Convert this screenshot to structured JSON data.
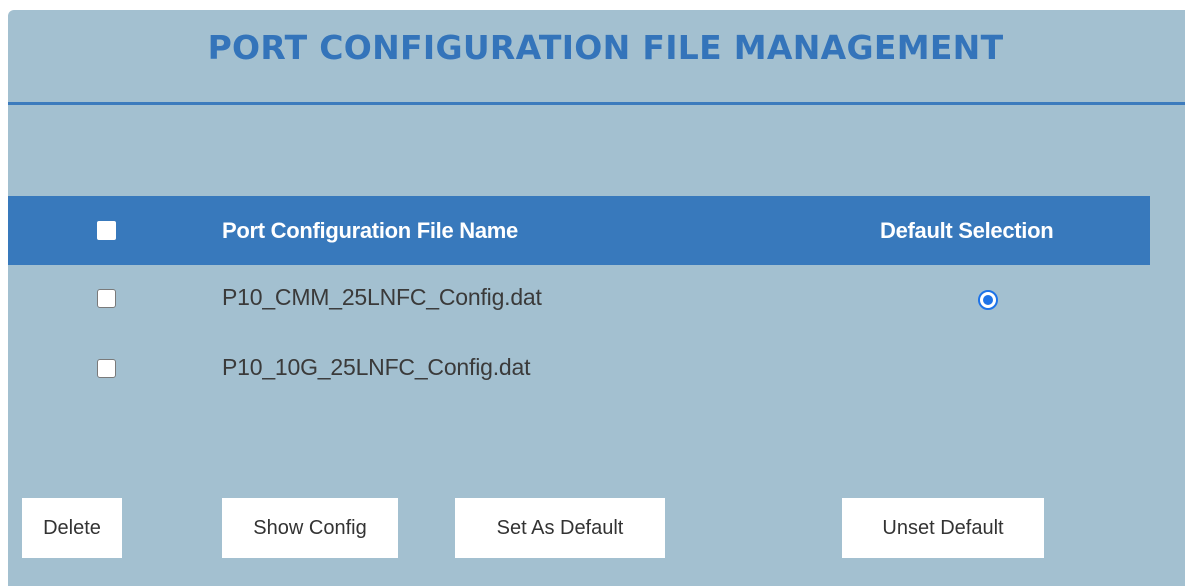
{
  "header": {
    "title": "PORT CONFIGURATION FILE MANAGEMENT"
  },
  "table": {
    "columns": {
      "select_all": "",
      "file_name": "Port Configuration File Name",
      "default_selection": "Default Selection"
    },
    "rows": [
      {
        "file_name": "P10_CMM_25LNFC_Config.dat",
        "checked": false,
        "is_default": true
      },
      {
        "file_name": "P10_10G_25LNFC_Config.dat",
        "checked": false,
        "is_default": false
      }
    ]
  },
  "actions": {
    "delete_label": "Delete",
    "show_config_label": "Show Config",
    "set_default_label": "Set As Default",
    "unset_default_label": "Unset Default"
  },
  "colors": {
    "panel_background": "#a3c0d0",
    "title_color": "#3474ba",
    "header_background": "#3879bc",
    "radio_accent": "#1d73e8"
  },
  "icons": {
    "select_all": "checkbox",
    "row_select": "checkbox",
    "default_radio": "radio-button"
  }
}
